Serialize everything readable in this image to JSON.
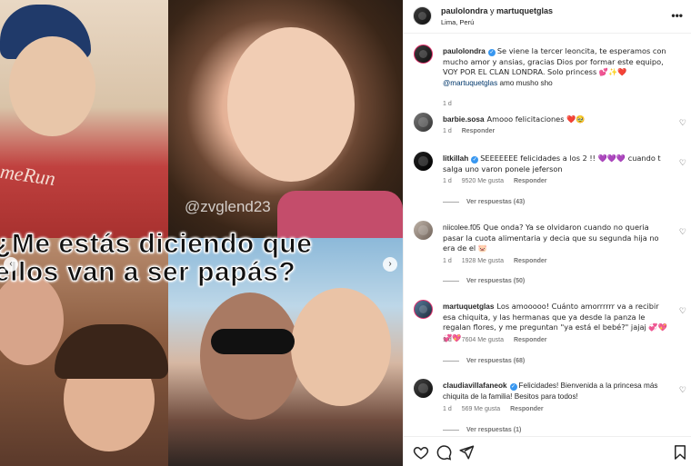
{
  "media": {
    "watermark": "@zvglend23",
    "headline_line1": "¿Me estás diciendo que",
    "headline_line2": "ellos van a ser papás?",
    "shirt_text": "meRun"
  },
  "header": {
    "user1": "paulolondra",
    "conjunction": "y",
    "user2": "martuquetglas",
    "location": "Lima, Perú",
    "more_icon": "more-horizontal-icon"
  },
  "caption": {
    "user": "paulolondra",
    "text": "Se viene la tercer leoncita, te esperamos con mucho amor y ansias, gracias Dios por formar este equipo, VOY POR EL CLAN LONDRA. Solo princess 💕✨❤️",
    "mention": "@martuquetglas",
    "text_after": " amo musho sho",
    "time": "1 d"
  },
  "comments": [
    {
      "user": "barbie.sosa",
      "verified": false,
      "text": "Amooo felicitaciones ❤️🥹",
      "time": "1 d",
      "likes": "",
      "reply_label": "Responder",
      "replies": ""
    },
    {
      "user": "litkillah",
      "verified": true,
      "text": "SEEEEEEE felicidades a los 2 !! 💜💜💜 cuando t salga uno varon ponele jeferson",
      "time": "1 d",
      "likes": "9520 Me gusta",
      "reply_label": "Responder",
      "replies": "Ver respuestas (43)"
    },
    {
      "user": "niicolee.f05",
      "verified": false,
      "text": "Que onda? Ya se olvidaron cuando no queria pasar la cuota alimentaria y decia que su segunda hija no era de el 🐷",
      "time": "1 d",
      "likes": "1928 Me gusta",
      "reply_label": "Responder",
      "replies": "Ver respuestas (50)"
    },
    {
      "user": "martuquetglas",
      "verified": false,
      "text": "Los amooooo! Cuánto amorrrrrr va a recibir esa chiquita, y las hermanas que ya desde la panza le regalan flores, y me preguntan \"ya está el bebé?\" jajaj 💞💖💞💖",
      "time": "1 d",
      "likes": "7604 Me gusta",
      "reply_label": "Responder",
      "replies": "Ver respuestas (68)"
    },
    {
      "user": "claudiavillafaneok",
      "verified": true,
      "text": "Felicidades! Bienvenida a la princesa más chiquita de la familia! Besitos para todos!",
      "time": "1 d",
      "likes": "569 Me gusta",
      "reply_label": "Responder",
      "replies": "Ver respuestas (1)"
    }
  ],
  "actions": {
    "like_icon": "heart-icon",
    "comment_icon": "comment-icon",
    "share_icon": "send-icon",
    "save_icon": "bookmark-icon"
  },
  "colors": {
    "verified": "#3897f0",
    "mention": "#00376b",
    "muted": "#737373"
  }
}
